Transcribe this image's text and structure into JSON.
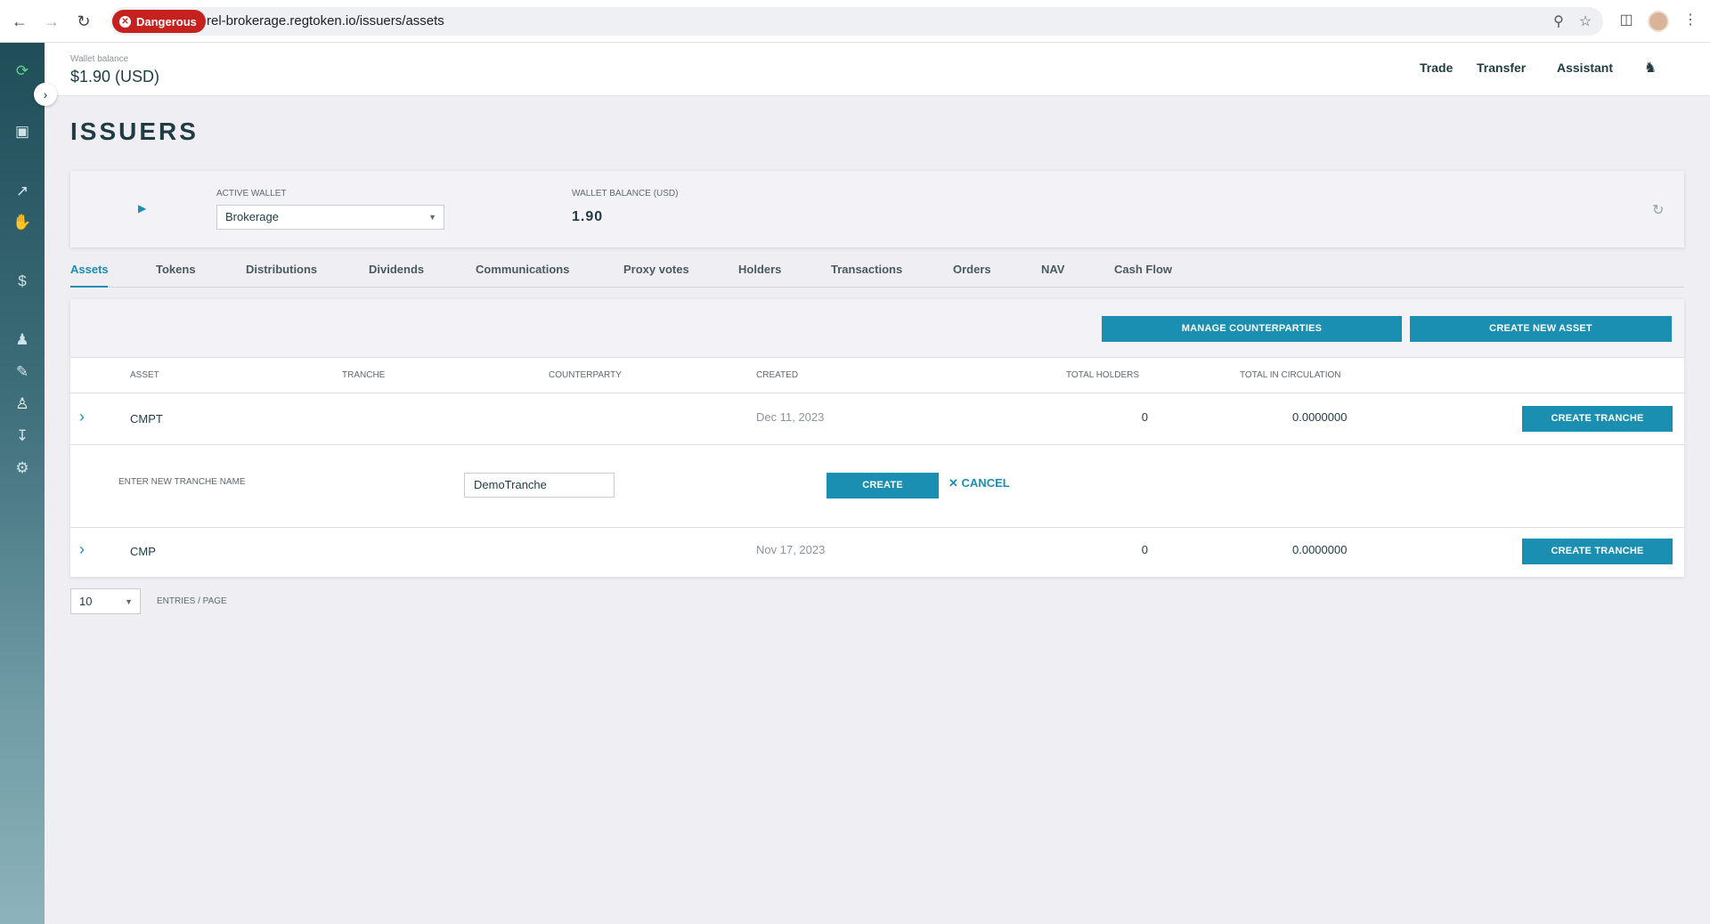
{
  "browser": {
    "security_chip": "Dangerous",
    "url": "rel-brokerage.regtoken.io/issuers/assets"
  },
  "header": {
    "wallet_balance_label": "Wallet balance",
    "wallet_balance_value": "$1.90 (USD)",
    "links": [
      "Trade",
      "Transfer",
      "Assistant"
    ]
  },
  "page": {
    "title": "ISSUERS"
  },
  "wallet": {
    "active_wallet_label": "ACTIVE WALLET",
    "active_wallet_value": "Brokerage",
    "balance_label": "WALLET BALANCE (USD)",
    "balance_value": "1.90"
  },
  "tabs": [
    "Assets",
    "Tokens",
    "Distributions",
    "Dividends",
    "Communications",
    "Proxy votes",
    "Holders",
    "Transactions",
    "Orders",
    "NAV",
    "Cash Flow"
  ],
  "toolbar": {
    "manage_label": "MANAGE COUNTERPARTIES",
    "create_asset_label": "CREATE NEW ASSET"
  },
  "table": {
    "columns": [
      "ASSET",
      "TRANCHE",
      "COUNTERPARTY",
      "CREATED",
      "TOTAL HOLDERS",
      "TOTAL IN CIRCULATION"
    ],
    "rows": [
      {
        "asset": "CMPT",
        "created": "Dec 11, 2023",
        "holders": "0",
        "circulation": "0.0000000",
        "action": "CREATE TRANCHE"
      },
      {
        "asset": "CMP",
        "created": "Nov 17, 2023",
        "holders": "0",
        "circulation": "0.0000000",
        "action": "CREATE TRANCHE"
      }
    ],
    "tranche_form": {
      "label": "ENTER NEW TRANCHE NAME",
      "value": "DemoTranche",
      "create_label": "CREATE",
      "cancel_label": "CANCEL"
    }
  },
  "pagination": {
    "page_size": "10",
    "label": "ENTRIES / PAGE"
  }
}
